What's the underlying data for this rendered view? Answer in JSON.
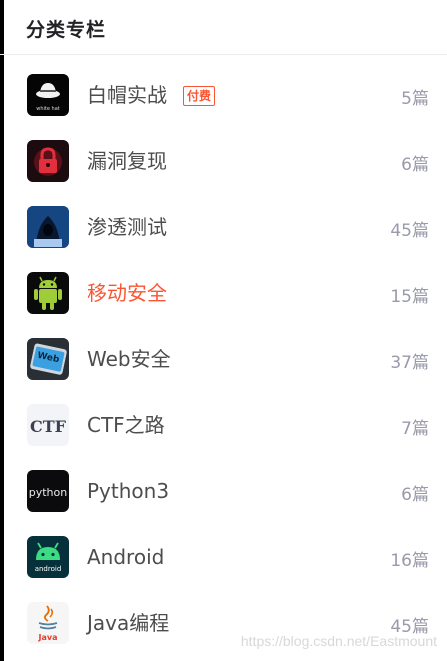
{
  "header": {
    "title": "分类专栏"
  },
  "columns": [
    {
      "name": "白帽实战",
      "badge": "付费",
      "count": "5篇",
      "icon": "white-hat-logo"
    },
    {
      "name": "漏洞复现",
      "count": "6篇",
      "icon": "red-lock-image"
    },
    {
      "name": "渗透测试",
      "count": "45篇",
      "icon": "hooded-hacker-image"
    },
    {
      "name": "移动安全",
      "count": "15篇",
      "icon": "android-robot-logo",
      "active": true
    },
    {
      "name": "Web安全",
      "count": "37篇",
      "icon": "web-security-key-image"
    },
    {
      "name": "CTF之路",
      "count": "7篇",
      "icon": "ctf-logo"
    },
    {
      "name": "Python3",
      "count": "6篇",
      "icon": "python-logo"
    },
    {
      "name": "Android",
      "count": "16篇",
      "icon": "android-logo"
    },
    {
      "name": "Java编程",
      "count": "45篇",
      "icon": "java-logo"
    }
  ],
  "watermark": "https://blog.csdn.net/Eastmount",
  "colors": {
    "accent": "#fc5531",
    "text": "#4d4d4d",
    "count": "#999aaa"
  },
  "thumb_labels": {
    "white_hat": "white hat",
    "web": "Web",
    "ctf": "CTF",
    "python": "python",
    "android": "android",
    "java": "Java"
  }
}
